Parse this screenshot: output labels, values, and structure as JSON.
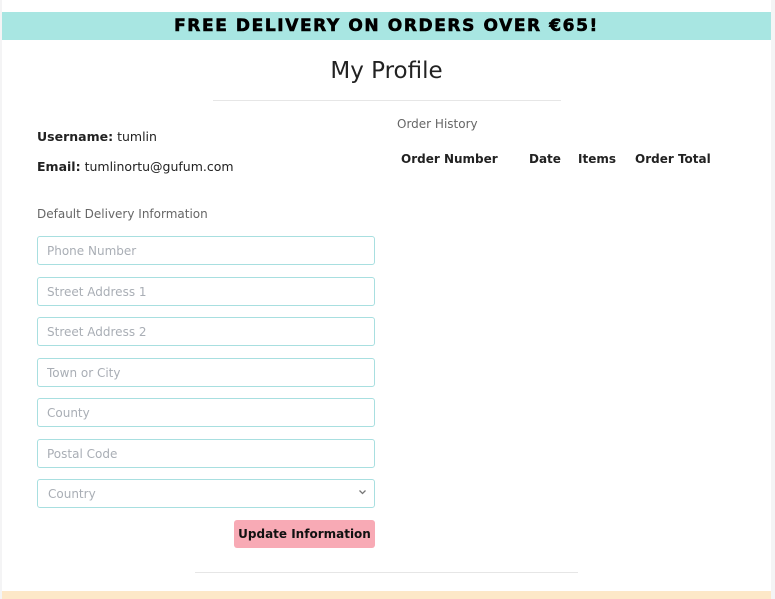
{
  "banner": {
    "text": "FREE DELIVERY ON ORDERS OVER €65!"
  },
  "page": {
    "title": "My Profile"
  },
  "user": {
    "username_label": "Username:",
    "username": "tumlin",
    "email_label": "Email:",
    "email": "tumlinortu@gufum.com"
  },
  "delivery": {
    "section_label": "Default Delivery Information",
    "fields": {
      "phone": {
        "placeholder": "Phone Number",
        "value": ""
      },
      "street1": {
        "placeholder": "Street Address 1",
        "value": ""
      },
      "street2": {
        "placeholder": "Street Address 2",
        "value": ""
      },
      "town": {
        "placeholder": "Town or City",
        "value": ""
      },
      "county": {
        "placeholder": "County",
        "value": ""
      },
      "postcode": {
        "placeholder": "Postal Code",
        "value": ""
      }
    },
    "country": {
      "selected": "Country"
    },
    "submit_label": "Update Information"
  },
  "orders": {
    "section_label": "Order History",
    "columns": [
      "Order Number",
      "Date",
      "Items",
      "Order Total"
    ],
    "rows": []
  },
  "colors": {
    "banner_bg": "#a8e6e2",
    "field_border": "#a8dfe0",
    "button_bg": "#f8aab5",
    "footer_bg": "#fde8c8"
  },
  "icons": {
    "select_arrow": "chevron-down-icon"
  }
}
